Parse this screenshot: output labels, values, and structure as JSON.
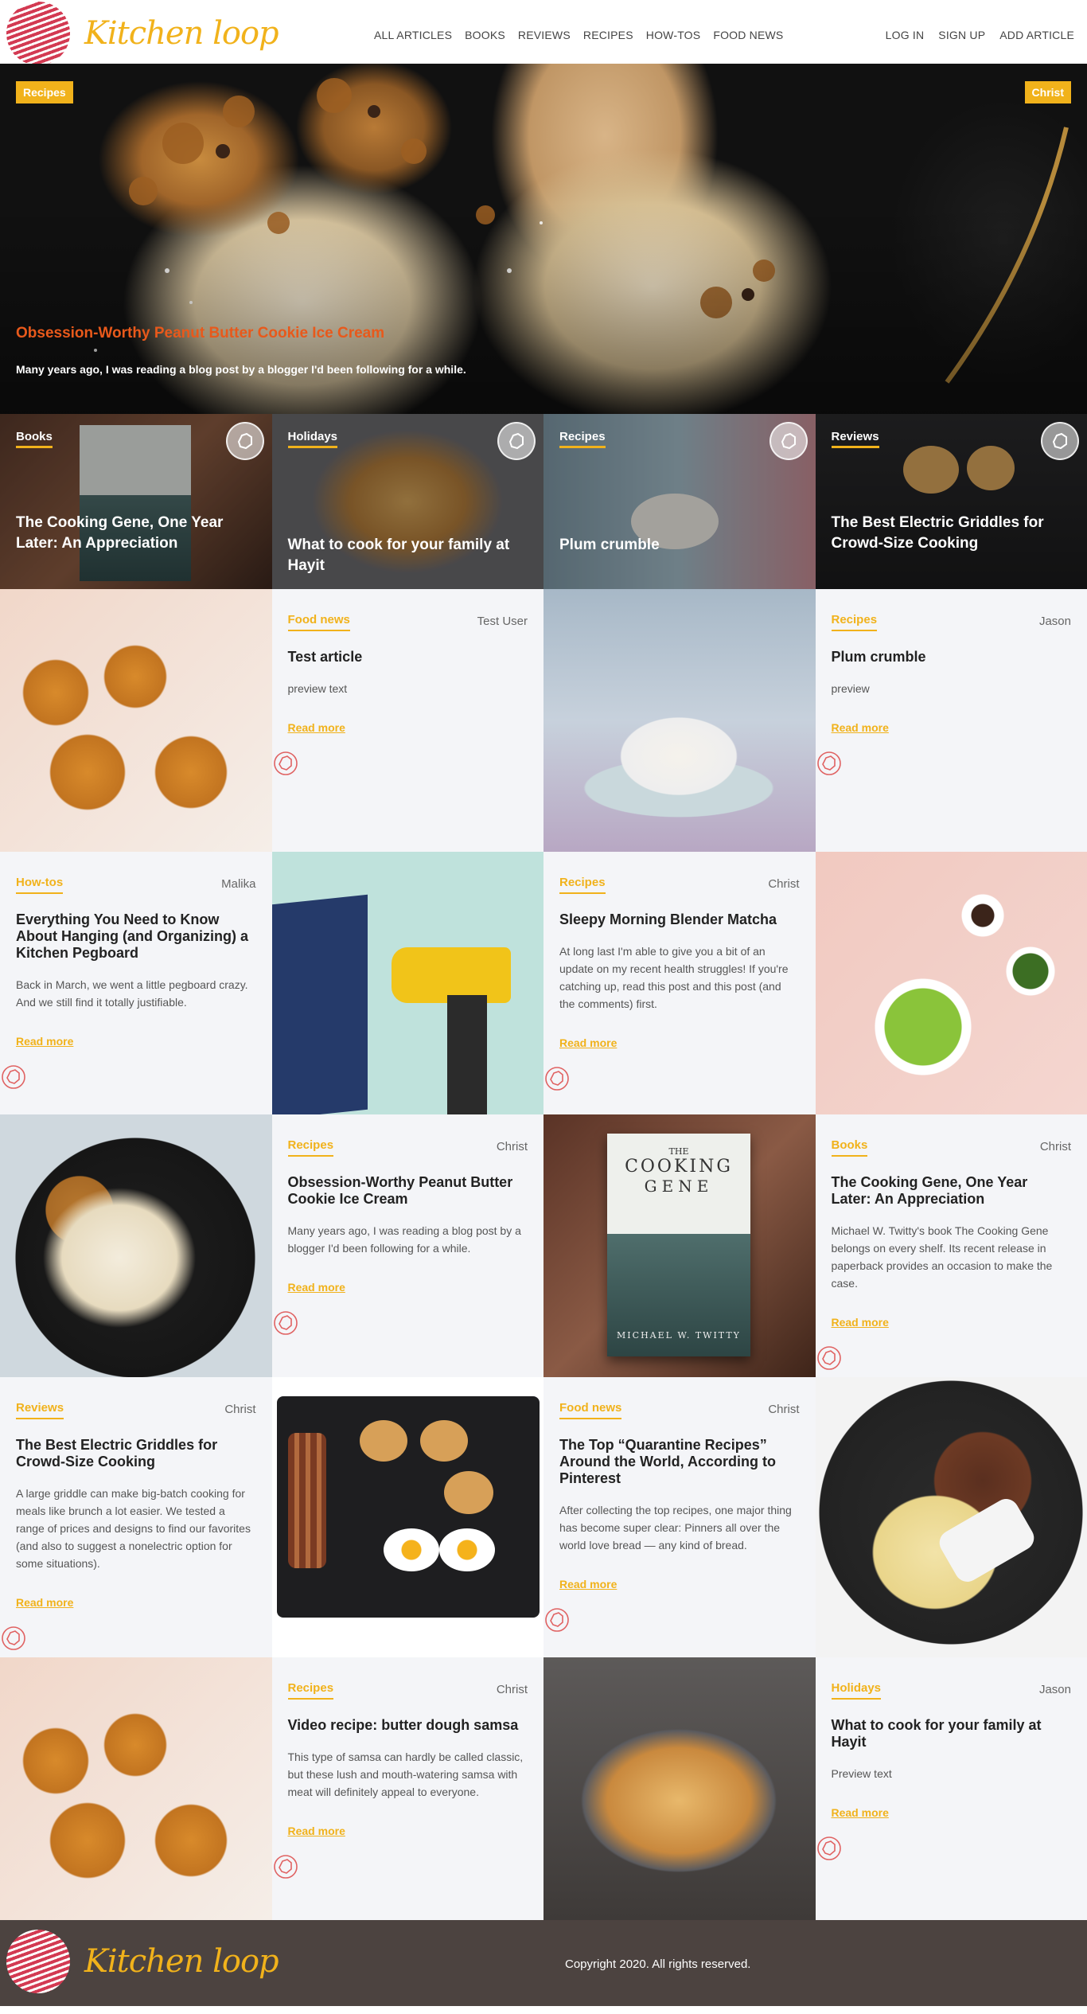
{
  "brand": {
    "name": "Kitchen loop"
  },
  "nav": {
    "items": [
      "ALL ARTICLES",
      "BOOKS",
      "REVIEWS",
      "RECIPES",
      "HOW-TOS",
      "FOOD NEWS"
    ]
  },
  "user_nav": {
    "items": [
      "LOG IN",
      "SIGN UP",
      "ADD ARTICLE"
    ]
  },
  "hero": {
    "category": "Recipes",
    "author": "Christ",
    "title": "Obsession-Worthy Peanut Butter Cookie Ice Cream",
    "subtitle": "Many years ago, I was reading a blog post by a blogger I'd been following for a while."
  },
  "featured": [
    {
      "category": "Books",
      "title": "The Cooking Gene, One Year Later: An Appreciation"
    },
    {
      "category": "Holidays",
      "title": "What to cook for your family at Hayit"
    },
    {
      "category": "Recipes",
      "title": "Plum crumble"
    },
    {
      "category": "Reviews",
      "title": "The Best Electric Griddles for Crowd-Size Cooking"
    }
  ],
  "articles": [
    {
      "category": "Food news",
      "author": "Test User",
      "title": "Test article",
      "excerpt": "preview text",
      "more": "Read more"
    },
    {
      "category": "Recipes",
      "author": "Jason",
      "title": "Plum crumble",
      "excerpt": "preview",
      "more": "Read more"
    },
    {
      "category": "How-tos",
      "author": "Malika",
      "title": "Everything You Need to Know About Hanging (and Organizing) a Kitchen Pegboard",
      "excerpt": "Back in March, we went a little pegboard crazy. And we still find it totally justifiable.",
      "more": "Read more"
    },
    {
      "category": "Recipes",
      "author": "Christ",
      "title": "Sleepy Morning Blender Matcha",
      "excerpt": "At long last I'm able to give you a bit of an update on my recent health struggles! If you're catching up, read this post and this post (and the comments) first.",
      "more": "Read more"
    },
    {
      "category": "Recipes",
      "author": "Christ",
      "title": "Obsession-Worthy Peanut Butter Cookie Ice Cream",
      "excerpt": "Many years ago, I was reading a blog post by a blogger I'd been following for a while.",
      "more": "Read more"
    },
    {
      "category": "Books",
      "author": "Christ",
      "title": "The Cooking Gene, One Year Later: An Appreciation",
      "excerpt": "Michael W. Twitty's book The Cooking Gene belongs on every shelf. Its recent release in paperback provides an occasion to make the case.",
      "more": "Read more"
    },
    {
      "category": "Reviews",
      "author": "Christ",
      "title": "The Best Electric Griddles for Crowd-Size Cooking",
      "excerpt": "A large griddle can make big-batch cooking for meals like brunch a lot easier. We tested a range of prices and designs to find our favorites (and also to suggest a nonelectric option for some situations).",
      "more": "Read more"
    },
    {
      "category": "Food news",
      "author": "Christ",
      "title": "The Top “Quarantine Recipes” Around the World, According to Pinterest",
      "excerpt": "After collecting the top recipes, one major thing has become super clear: Pinners all over the world love bread — any kind of bread.",
      "more": "Read more"
    },
    {
      "category": "Recipes",
      "author": "Christ",
      "title": "Video recipe: butter dough samsa",
      "excerpt": "This type of samsa can hardly be called classic, but these lush and mouth-watering samsa with meat will definitely appeal to everyone.",
      "more": "Read more"
    },
    {
      "category": "Holidays",
      "author": "Jason",
      "title": "What to cook for your family at Hayit",
      "excerpt": "Preview text",
      "more": "Read more"
    }
  ],
  "book_cover": {
    "line1": "THE",
    "line2": "COOKING",
    "line3": "GENE",
    "author": "MICHAEL W. TWITTY"
  },
  "footer": {
    "copyright": "Copyright 2020. All rights reserved."
  },
  "colors": {
    "accent": "#f1b21b",
    "hero_title": "#e8591b",
    "footer_bg": "#4c4340",
    "card_bg": "#f4f5f8"
  }
}
